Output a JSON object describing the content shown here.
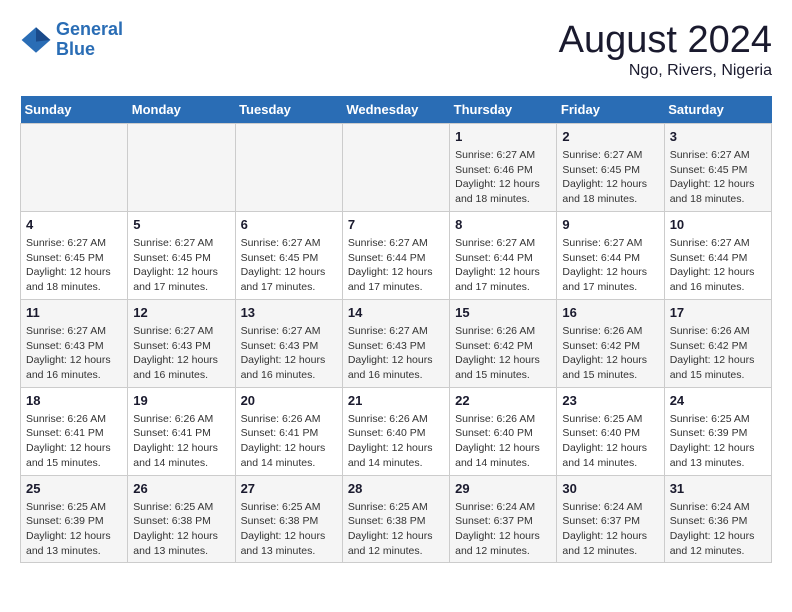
{
  "logo": {
    "line1": "General",
    "line2": "Blue"
  },
  "title": "August 2024",
  "subtitle": "Ngo, Rivers, Nigeria",
  "days_of_week": [
    "Sunday",
    "Monday",
    "Tuesday",
    "Wednesday",
    "Thursday",
    "Friday",
    "Saturday"
  ],
  "weeks": [
    [
      {
        "day": "",
        "sunrise": "",
        "sunset": "",
        "daylight": ""
      },
      {
        "day": "",
        "sunrise": "",
        "sunset": "",
        "daylight": ""
      },
      {
        "day": "",
        "sunrise": "",
        "sunset": "",
        "daylight": ""
      },
      {
        "day": "",
        "sunrise": "",
        "sunset": "",
        "daylight": ""
      },
      {
        "day": "1",
        "sunrise": "6:27 AM",
        "sunset": "6:46 PM",
        "daylight": "12 hours and 18 minutes."
      },
      {
        "day": "2",
        "sunrise": "6:27 AM",
        "sunset": "6:45 PM",
        "daylight": "12 hours and 18 minutes."
      },
      {
        "day": "3",
        "sunrise": "6:27 AM",
        "sunset": "6:45 PM",
        "daylight": "12 hours and 18 minutes."
      }
    ],
    [
      {
        "day": "4",
        "sunrise": "6:27 AM",
        "sunset": "6:45 PM",
        "daylight": "12 hours and 18 minutes."
      },
      {
        "day": "5",
        "sunrise": "6:27 AM",
        "sunset": "6:45 PM",
        "daylight": "12 hours and 17 minutes."
      },
      {
        "day": "6",
        "sunrise": "6:27 AM",
        "sunset": "6:45 PM",
        "daylight": "12 hours and 17 minutes."
      },
      {
        "day": "7",
        "sunrise": "6:27 AM",
        "sunset": "6:44 PM",
        "daylight": "12 hours and 17 minutes."
      },
      {
        "day": "8",
        "sunrise": "6:27 AM",
        "sunset": "6:44 PM",
        "daylight": "12 hours and 17 minutes."
      },
      {
        "day": "9",
        "sunrise": "6:27 AM",
        "sunset": "6:44 PM",
        "daylight": "12 hours and 17 minutes."
      },
      {
        "day": "10",
        "sunrise": "6:27 AM",
        "sunset": "6:44 PM",
        "daylight": "12 hours and 16 minutes."
      }
    ],
    [
      {
        "day": "11",
        "sunrise": "6:27 AM",
        "sunset": "6:43 PM",
        "daylight": "12 hours and 16 minutes."
      },
      {
        "day": "12",
        "sunrise": "6:27 AM",
        "sunset": "6:43 PM",
        "daylight": "12 hours and 16 minutes."
      },
      {
        "day": "13",
        "sunrise": "6:27 AM",
        "sunset": "6:43 PM",
        "daylight": "12 hours and 16 minutes."
      },
      {
        "day": "14",
        "sunrise": "6:27 AM",
        "sunset": "6:43 PM",
        "daylight": "12 hours and 16 minutes."
      },
      {
        "day": "15",
        "sunrise": "6:26 AM",
        "sunset": "6:42 PM",
        "daylight": "12 hours and 15 minutes."
      },
      {
        "day": "16",
        "sunrise": "6:26 AM",
        "sunset": "6:42 PM",
        "daylight": "12 hours and 15 minutes."
      },
      {
        "day": "17",
        "sunrise": "6:26 AM",
        "sunset": "6:42 PM",
        "daylight": "12 hours and 15 minutes."
      }
    ],
    [
      {
        "day": "18",
        "sunrise": "6:26 AM",
        "sunset": "6:41 PM",
        "daylight": "12 hours and 15 minutes."
      },
      {
        "day": "19",
        "sunrise": "6:26 AM",
        "sunset": "6:41 PM",
        "daylight": "12 hours and 14 minutes."
      },
      {
        "day": "20",
        "sunrise": "6:26 AM",
        "sunset": "6:41 PM",
        "daylight": "12 hours and 14 minutes."
      },
      {
        "day": "21",
        "sunrise": "6:26 AM",
        "sunset": "6:40 PM",
        "daylight": "12 hours and 14 minutes."
      },
      {
        "day": "22",
        "sunrise": "6:26 AM",
        "sunset": "6:40 PM",
        "daylight": "12 hours and 14 minutes."
      },
      {
        "day": "23",
        "sunrise": "6:25 AM",
        "sunset": "6:40 PM",
        "daylight": "12 hours and 14 minutes."
      },
      {
        "day": "24",
        "sunrise": "6:25 AM",
        "sunset": "6:39 PM",
        "daylight": "12 hours and 13 minutes."
      }
    ],
    [
      {
        "day": "25",
        "sunrise": "6:25 AM",
        "sunset": "6:39 PM",
        "daylight": "12 hours and 13 minutes."
      },
      {
        "day": "26",
        "sunrise": "6:25 AM",
        "sunset": "6:38 PM",
        "daylight": "12 hours and 13 minutes."
      },
      {
        "day": "27",
        "sunrise": "6:25 AM",
        "sunset": "6:38 PM",
        "daylight": "12 hours and 13 minutes."
      },
      {
        "day": "28",
        "sunrise": "6:25 AM",
        "sunset": "6:38 PM",
        "daylight": "12 hours and 12 minutes."
      },
      {
        "day": "29",
        "sunrise": "6:24 AM",
        "sunset": "6:37 PM",
        "daylight": "12 hours and 12 minutes."
      },
      {
        "day": "30",
        "sunrise": "6:24 AM",
        "sunset": "6:37 PM",
        "daylight": "12 hours and 12 minutes."
      },
      {
        "day": "31",
        "sunrise": "6:24 AM",
        "sunset": "6:36 PM",
        "daylight": "12 hours and 12 minutes."
      }
    ]
  ]
}
